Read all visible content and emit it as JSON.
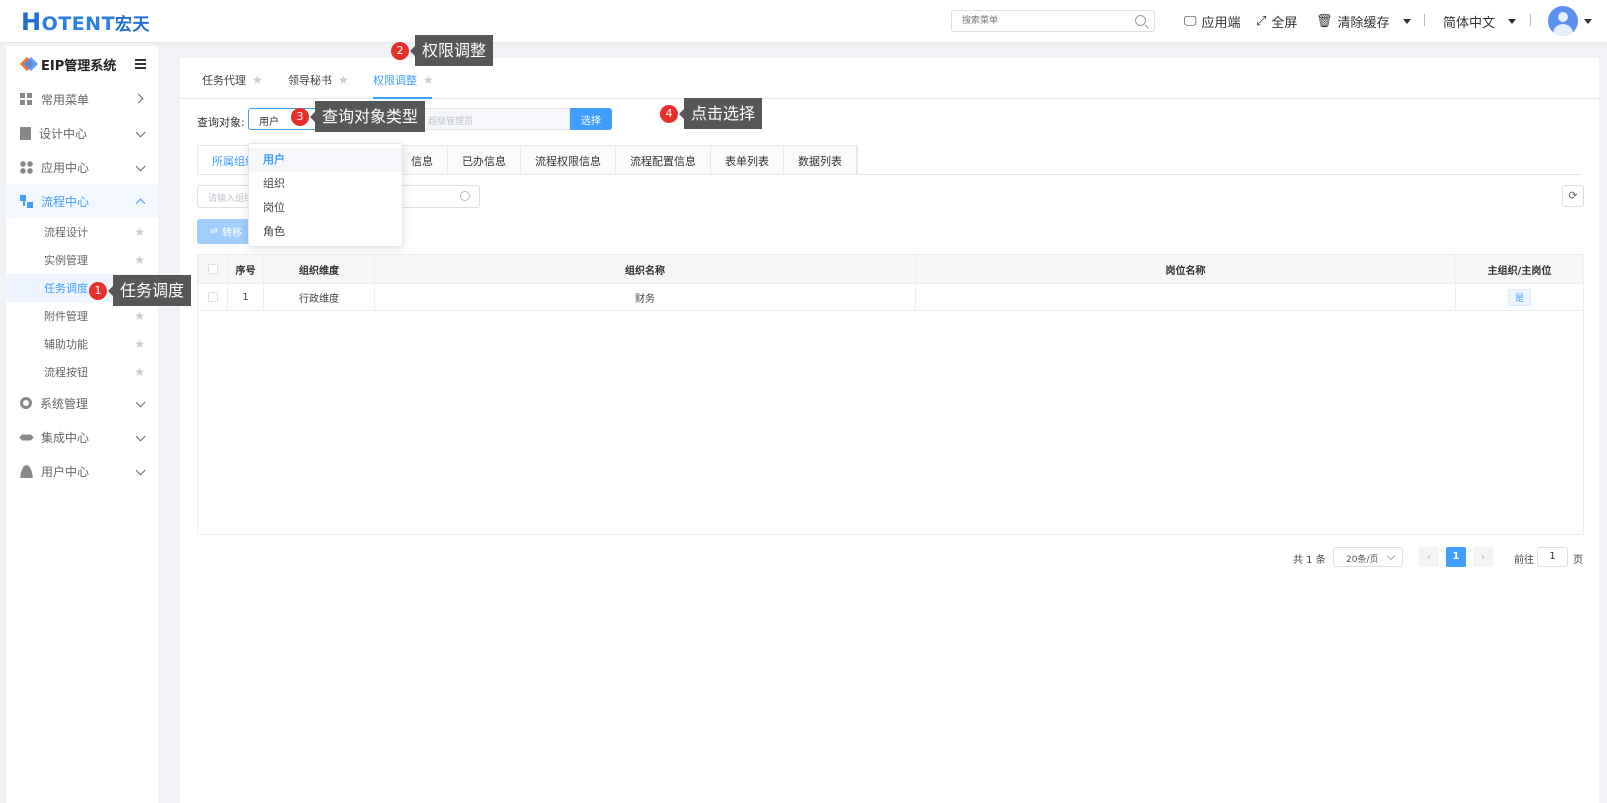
{
  "header": {
    "logo_h": "H",
    "logo_text": "OTENT",
    "logo_cn": "宏天",
    "search_placeholder": "搜索菜单",
    "app_label": "应用端",
    "fullscreen_label": "全屏",
    "clear_cache_label": "清除缓存",
    "language_label": "简体中文"
  },
  "sidebar": {
    "title": "EIP管理系统",
    "menus": [
      {
        "label": "常用菜单"
      },
      {
        "label": "设计中心"
      },
      {
        "label": "应用中心"
      },
      {
        "label": "流程中心"
      },
      {
        "label": "系统管理"
      },
      {
        "label": "集成中心"
      },
      {
        "label": "用户中心"
      }
    ],
    "sub_items": [
      {
        "label": "流程设计"
      },
      {
        "label": "实例管理"
      },
      {
        "label": "任务调度"
      },
      {
        "label": "附件管理"
      },
      {
        "label": "辅助功能"
      },
      {
        "label": "流程按钮"
      }
    ]
  },
  "top_tabs": [
    {
      "label": "任务代理"
    },
    {
      "label": "领导秘书"
    },
    {
      "label": "权限调整"
    }
  ],
  "query": {
    "label": "查询对象:",
    "type_value": "用户",
    "input_placeholder": "超级管理员",
    "select_button": "选择"
  },
  "sub_tabs": [
    {
      "label": "所属组织"
    },
    {
      "label": "信息"
    },
    {
      "label": "已办信息"
    },
    {
      "label": "流程权限信息"
    },
    {
      "label": "流程配置信息"
    },
    {
      "label": "表单列表"
    },
    {
      "label": "数据列表"
    }
  ],
  "filter": {
    "placeholder": "请输入组织"
  },
  "transfer_button": "转移",
  "table": {
    "columns": [
      "序号",
      "组织维度",
      "组织名称",
      "岗位名称",
      "主组织/主岗位"
    ],
    "rows": [
      {
        "index": "1",
        "dimension": "行政维度",
        "org_name": "财务",
        "position": "",
        "main": "是"
      }
    ]
  },
  "pagination": {
    "total": "共 1 条",
    "page_size": "20条/页",
    "current_page": "1",
    "goto_label": "前往",
    "goto_value": "1",
    "page_unit": "页"
  },
  "dropdown": {
    "options": [
      "用户",
      "组织",
      "岗位",
      "角色"
    ]
  },
  "callouts": [
    {
      "num": "1",
      "text": "任务调度"
    },
    {
      "num": "2",
      "text": "权限调整"
    },
    {
      "num": "3",
      "text": "查询对象类型"
    },
    {
      "num": "4",
      "text": "点击选择"
    }
  ]
}
